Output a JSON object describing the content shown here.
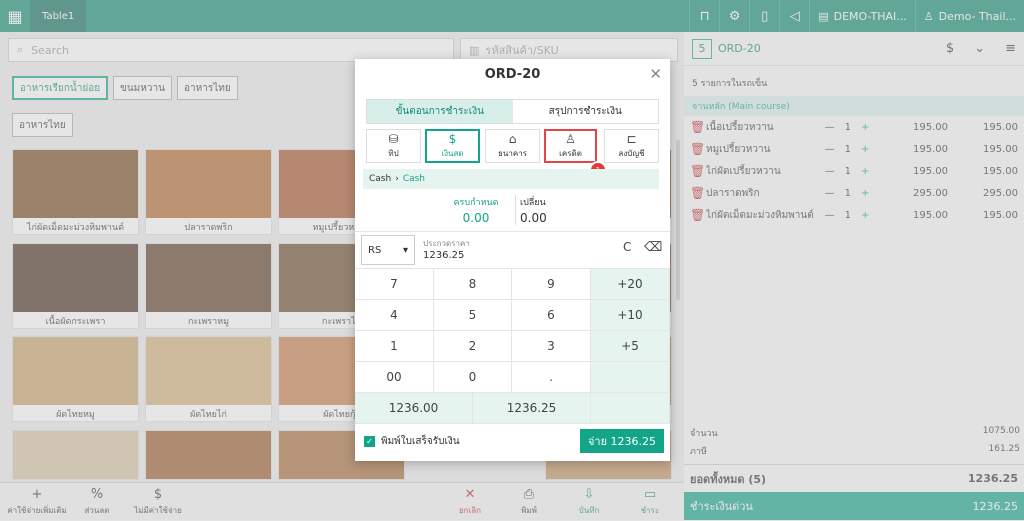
{
  "topbar": {
    "table": "Table1",
    "store": "DEMO-THAI...",
    "user": "Demo- Thail..."
  },
  "search": {
    "placeholder": "Search"
  },
  "sku": {
    "placeholder": "รหัสสินค้า/SKU"
  },
  "categories": [
    "อาหารเรียกน้ำย่อย",
    "ขนมหวาน",
    "อาหารไทย",
    "อาหารไทย"
  ],
  "products": [
    "ไก่ผัดเม็ดมะม่วงหิมพานต์",
    "ปลาราดพริก",
    "หมูเปรี้ยวหวาน",
    "เนื้อผัดกระเพรา",
    "กะเพราหมู",
    "กะเพราไก่",
    "ผัดไทยหมู",
    "ผัดไทยไก่",
    "ผัดไทยกุ้ง"
  ],
  "bottom_bar": {
    "extra": "ค่าใช้จ่ายเพิ่มเติม",
    "discount": "ส่วนลด",
    "no_cost": "ไม่มีค่าใช้จ่าย",
    "cancel": "ยกเลิก",
    "print": "พิมพ์",
    "save": "บันทึก",
    "pay": "ชำระ"
  },
  "order": {
    "number": "5",
    "id": "ORD-20",
    "count_label": "5 รายการในรถเข็น",
    "course": "จานหลัก (Main course)",
    "items": [
      {
        "name": "เนื้อเปรี้ยวหวาน",
        "qty": "1",
        "price": "195.00",
        "total": "195.00"
      },
      {
        "name": "หมูเปรี้ยวหวาน",
        "qty": "1",
        "price": "195.00",
        "total": "195.00"
      },
      {
        "name": "ไก่ผัดเปรี้ยวหวาน",
        "qty": "1",
        "price": "195.00",
        "total": "195.00"
      },
      {
        "name": "ปลาราดพริก",
        "qty": "1",
        "price": "295.00",
        "total": "295.00"
      },
      {
        "name": "ไก่ผัดเม็ดมะม่วงหิมพานต์",
        "qty": "1",
        "price": "195.00",
        "total": "195.00"
      }
    ],
    "subtotal_label": "จำนวน",
    "subtotal": "1075.00",
    "tax_label": "ภาษี",
    "tax": "161.25",
    "total_label": "ยอดทั้งหมด",
    "total_count": "(5)",
    "total": "1236.25",
    "quick_pay_label": "ชำระเงินด่วน",
    "quick_pay": "1236.25"
  },
  "modal": {
    "title": "ORD-20",
    "tabs": [
      "ขั้นตอนการชำระเงิน",
      "สรุปการชำระเงิน"
    ],
    "methods": [
      "ทิป",
      "เงินสด",
      "ธนาคาร",
      "เครดิต",
      "ลงบัญชี"
    ],
    "badge": "1",
    "crumb": [
      "Cash",
      "Cash"
    ],
    "due_label": "ครบกำหนด",
    "due_value": "0.00",
    "change_label": "เปลี่ยน",
    "change_value": "0.00",
    "currency": "RS",
    "received_label": "ประกวดราคา",
    "received_value": "1236.25",
    "clear": "C",
    "keys": [
      "7",
      "8",
      "9",
      "+20",
      "4",
      "5",
      "6",
      "+10",
      "1",
      "2",
      "3",
      "+5",
      "00",
      "0",
      "."
    ],
    "quick": [
      "1236.00",
      "1236.25"
    ],
    "print_label": "พิมพ์ใบเสร็จรับเงิน",
    "pay_button": "จ่าย 1236.25"
  },
  "colors": {
    "accent": "#13a58a",
    "topbar": "#0f8a70",
    "danger": "#c0262d"
  }
}
